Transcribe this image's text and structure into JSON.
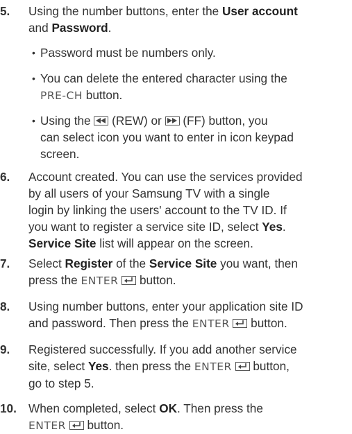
{
  "steps": [
    {
      "number": "5.",
      "text": {
        "a": "Using the number buttons, enter the ",
        "b": "User account",
        "c": "and ",
        "d": "Password",
        "e": "."
      },
      "bullets": [
        {
          "text": "Password must be numbers only."
        },
        {
          "a": "You can delete the entered character using the",
          "btn": "PRE-CH",
          "b": " button."
        },
        {
          "a": "Using the ",
          "rew_label": " (REW) or ",
          "ff_label": " (FF) button, you",
          "b": "can select icon you want to enter in icon keypad",
          "c": "screen."
        }
      ]
    },
    {
      "number": "6.",
      "lines": [
        "Account created. You can use the services provided",
        "by all users of your Samsung TV with a single",
        "login by linking the users' account to the TV ID. If"
      ],
      "l4a": "you want to register a service site ID, select ",
      "l4b": "Yes",
      "l4c": ".",
      "l5a": "Service Site",
      "l5b": " list will appear on the screen."
    },
    {
      "number": "7.",
      "a": "Select ",
      "b": "Register",
      "c": " of the ",
      "d": "Service Site",
      "e": " you want, then",
      "f": "press the ",
      "btn": "ENTER",
      "g": " button."
    },
    {
      "number": "8.",
      "a": "Using number buttons, enter your application site ID",
      "b": "and password. Then press the ",
      "btn": "ENTER",
      "c": " button."
    },
    {
      "number": "9.",
      "a": "Registered successfully. If you add another service",
      "b": "site, select ",
      "yes": "Yes",
      "c": ". then press the ",
      "btn": "ENTER",
      "d": " button,",
      "e": "go to step 5."
    },
    {
      "number": "10.",
      "a": "When completed, select ",
      "ok": "OK",
      "b": ". Then press the",
      "btn": "ENTER",
      "c": " button."
    }
  ],
  "icons": [
    "rewind-icon",
    "fast-forward-icon",
    "enter-icon"
  ]
}
